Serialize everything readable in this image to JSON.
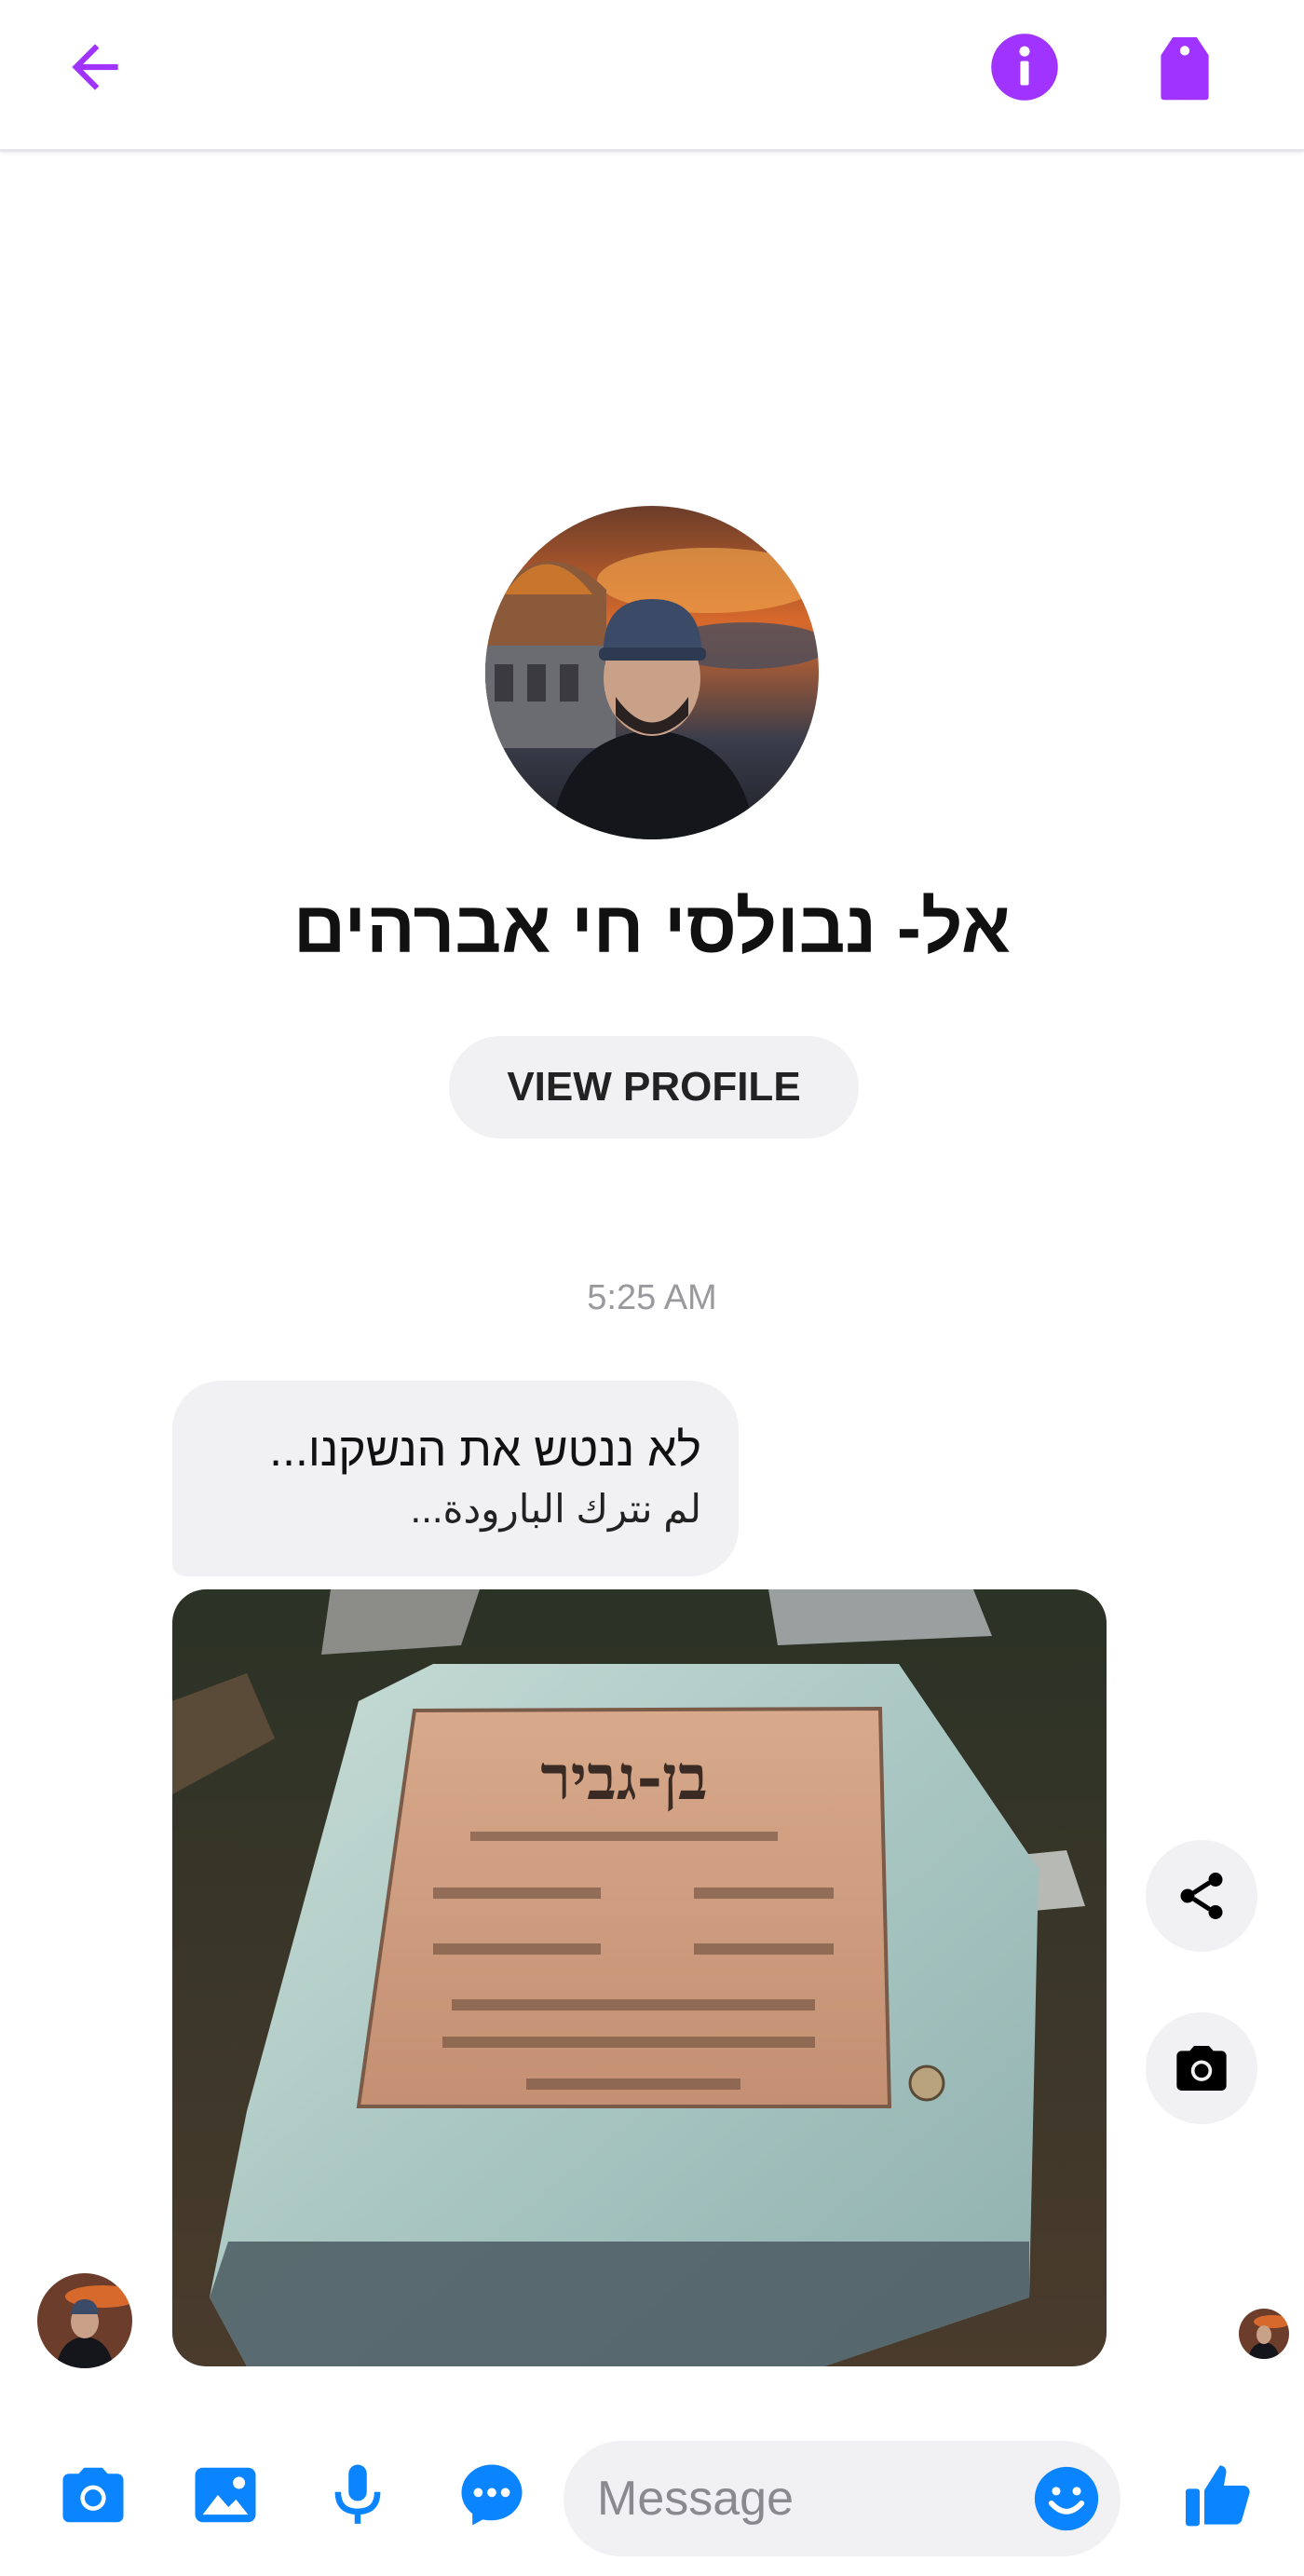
{
  "colors": {
    "accent_purple": "#a033ff",
    "accent_blue": "#0a84ff",
    "bubble_gray": "#f1f1f3"
  },
  "header": {
    "back_icon": "arrow-left-icon",
    "info_icon": "info-icon",
    "tag_icon": "tag-icon"
  },
  "profile": {
    "name": "אל- נבולסי חי אברהים",
    "view_profile_label": "VIEW PROFILE"
  },
  "conversation": {
    "timestamp": "5:25 AM",
    "text_message": {
      "line1": "לא ננטש את הנשקנו...",
      "line2": "لم نترك البارودة..."
    },
    "image_message": {
      "plaque_title": "בן-גביר"
    }
  },
  "composer": {
    "placeholder": "Message"
  }
}
